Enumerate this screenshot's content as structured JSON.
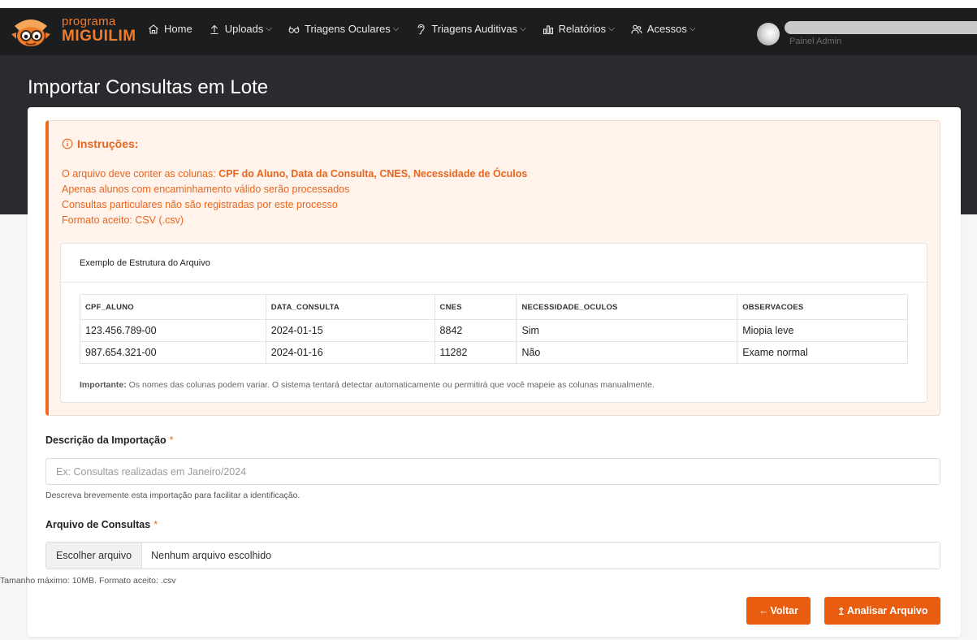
{
  "brand": {
    "small": "programa",
    "big": "MIGUILIM"
  },
  "nav": [
    {
      "label": "Home",
      "icon": "home-icon",
      "dropdown": false
    },
    {
      "label": "Uploads",
      "icon": "upload-icon",
      "dropdown": true
    },
    {
      "label": "Triagens Oculares",
      "icon": "glasses-icon",
      "dropdown": true
    },
    {
      "label": "Triagens Auditivas",
      "icon": "ear-icon",
      "dropdown": true
    },
    {
      "label": "Relatórios",
      "icon": "chart-icon",
      "dropdown": true
    },
    {
      "label": "Acessos",
      "icon": "users-icon",
      "dropdown": true
    }
  ],
  "user": {
    "role": "Painel Admin"
  },
  "page": {
    "title": "Importar Consultas em Lote"
  },
  "instructions": {
    "title": "Instruções:",
    "line1_prefix": "O arquivo deve conter as colunas: ",
    "line1_bold": "CPF do Aluno, Data da Consulta, CNES, Necessidade de Óculos",
    "line2": "Apenas alunos com encaminhamento válido serão processados",
    "line3": "Consultas particulares não são registradas por este processo",
    "line4": "Formato aceito: CSV (.csv)"
  },
  "example": {
    "title": "Exemplo de Estrutura do Arquivo",
    "headers": [
      "CPF_ALUNO",
      "DATA_CONSULTA",
      "CNES",
      "NECESSIDADE_OCULOS",
      "OBSERVACOES"
    ],
    "rows": [
      [
        "123.456.789-00",
        "2024-01-15",
        "8842",
        "Sim",
        "Miopia leve"
      ],
      [
        "987.654.321-00",
        "2024-01-16",
        "11282",
        "Não",
        "Exame normal"
      ]
    ],
    "note_bold": "Importante:",
    "note_text": " Os nomes das colunas podem variar. O sistema tentará detectar automaticamente ou permitirá que você mapeie as colunas manualmente."
  },
  "form": {
    "desc_label": "Descrição da Importação",
    "required_mark": "*",
    "desc_placeholder": "Ex: Consultas realizadas em Janeiro/2024",
    "desc_help": "Descreva brevemente esta importação para facilitar a identificação.",
    "file_label": "Arquivo de Consultas",
    "file_button": "Escolher arquivo",
    "file_none": "Nenhum arquivo escolhido",
    "file_help": "Tamanho máximo: 10MB. Formato aceito: .csv"
  },
  "actions": {
    "back": "Voltar",
    "analyze": "Analisar Arquivo"
  },
  "colors": {
    "accent": "#e85d0f",
    "alert_text": "#e8661d",
    "topbar": "#1c1d1f",
    "hero": "#2a2b2e"
  }
}
